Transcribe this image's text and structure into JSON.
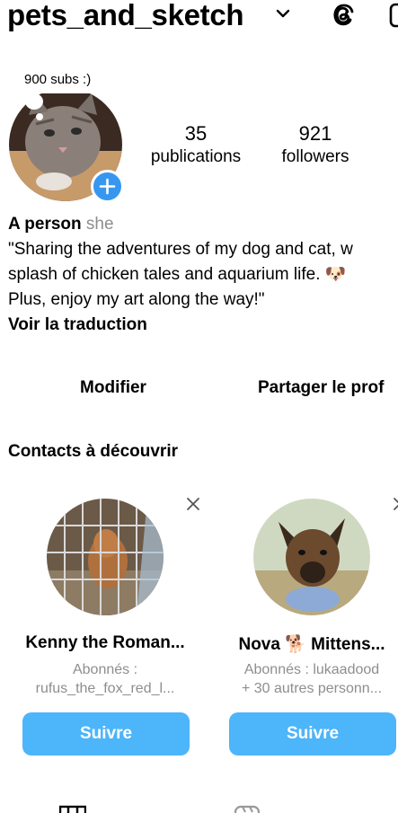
{
  "header": {
    "username": "pets_and_sketch",
    "icons": [
      "chevron-down-icon",
      "threads-icon",
      "plus-square-icon"
    ]
  },
  "note": "900 subs :)",
  "stats": {
    "publications_count": "35",
    "publications_label": "publications",
    "followers_count": "921",
    "followers_label": "followers"
  },
  "bio": {
    "name": "A person",
    "pronouns": "she",
    "line1": "\"Sharing the adventures of my dog and cat, w",
    "line2": "splash of chicken tales and aquarium life. 🐶",
    "line3": "Plus, enjoy my art along the way!\"",
    "translate": "Voir la traduction"
  },
  "buttons": {
    "edit": "Modifier",
    "share": "Partager le prof"
  },
  "contacts": {
    "title": "Contacts à découvrir",
    "cards": [
      {
        "name": "Kenny the Roman...",
        "sub1": "Abonnés :",
        "sub2": "rufus_the_fox_red_l...",
        "follow": "Suivre"
      },
      {
        "name": "Nova 🐕 Mittens...",
        "sub1": "Abonnés : lukaadood",
        "sub2": "+ 30 autres personn...",
        "follow": "Suivre"
      }
    ]
  },
  "colors": {
    "accent": "#3797f0",
    "follow_button": "#4db5f9",
    "secondary_text": "#8e8e8e"
  }
}
